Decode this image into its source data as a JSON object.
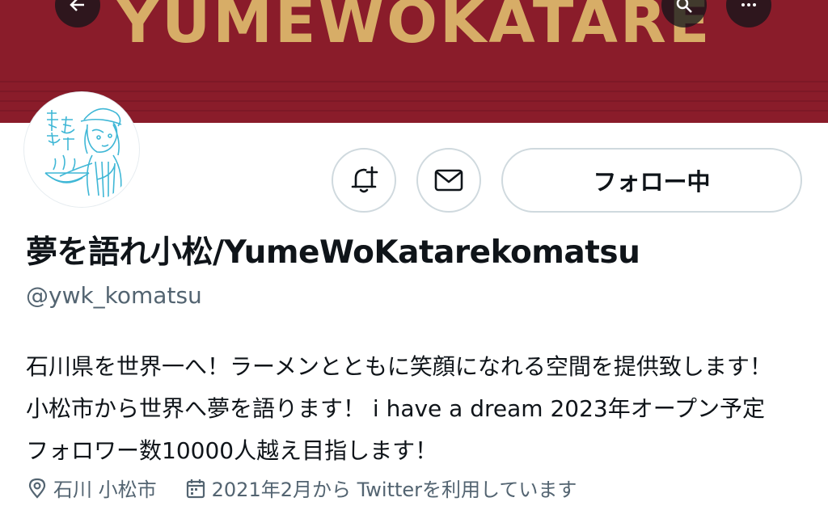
{
  "banner": {
    "text": "YUMEWOKATARE"
  },
  "actions": {
    "notify_icon": "bell-plus-icon",
    "message_icon": "mail-icon",
    "follow_label": "フォロー中"
  },
  "profile": {
    "display_name": "夢を語れ小松/YumeWoKatarekomatsu",
    "handle": "@ywk_komatsu",
    "bio": "石川県を世界一へ！ラーメンとともに笑顔になれる空間を提供致します！小松市から世界へ夢を語ります！ i have a dream 2023年オープン予定 フォロワー数10000人越え目指します！",
    "location": "石川 小松市",
    "joined": "2021年2月から Twitterを利用しています"
  },
  "colors": {
    "banner": "#8a1c2a",
    "banner_text": "#d7ad67",
    "avatar_line": "#3fb7d6",
    "secondary_text": "#536471",
    "border": "#cfd9de"
  }
}
